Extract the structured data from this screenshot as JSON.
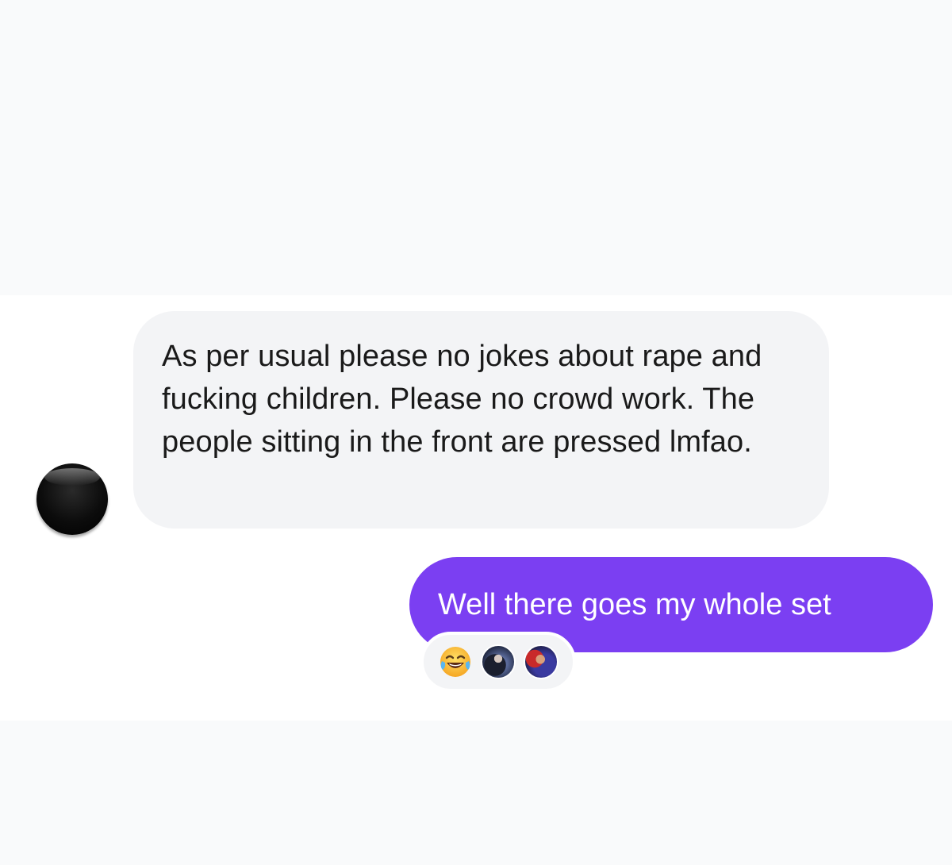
{
  "messages": {
    "incoming": {
      "text": "As per usual please no jokes about rape and fucking children. Please no crowd work. The people sitting in the front are pressed lmfao."
    },
    "outgoing": {
      "text": "Well there goes my whole set",
      "reactions": [
        {
          "type": "emoji",
          "icon": "face-with-tears-of-joy-icon"
        },
        {
          "type": "avatar",
          "icon": "reactor-avatar-1"
        },
        {
          "type": "avatar",
          "icon": "reactor-avatar-2"
        }
      ]
    }
  },
  "colors": {
    "outgoing_bubble": "#7b3ff2",
    "incoming_bubble": "#f3f4f6",
    "background": "#ffffff"
  }
}
